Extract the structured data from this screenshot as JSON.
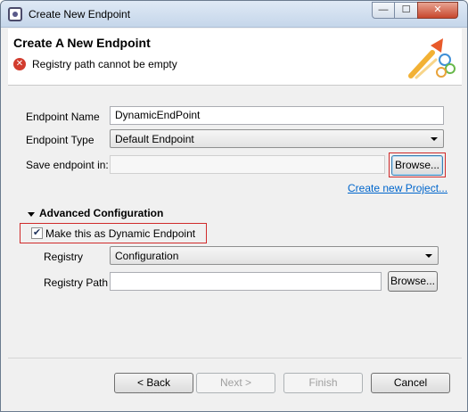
{
  "window": {
    "title": "Create New Endpoint",
    "controls": {
      "minimize": "—",
      "maximize": "☐",
      "close": "✕"
    }
  },
  "header": {
    "title": "Create A New Endpoint",
    "error_icon": "error-icon",
    "error_message": "Registry path cannot be empty"
  },
  "form": {
    "endpoint_name": {
      "label": "Endpoint Name",
      "value": "DynamicEndPoint"
    },
    "endpoint_type": {
      "label": "Endpoint Type",
      "value": "Default Endpoint"
    },
    "save_in": {
      "label": "Save endpoint in:",
      "value": "",
      "browse": "Browse..."
    },
    "create_project_link": "Create new Project..."
  },
  "advanced": {
    "title": "Advanced Configuration",
    "dynamic_checkbox": {
      "label": "Make this as Dynamic Endpoint",
      "checked": true,
      "check_glyph": "✔"
    },
    "registry": {
      "label": "Registry",
      "value": "Configuration"
    },
    "registry_path": {
      "label": "Registry Path",
      "value": "",
      "browse": "Browse..."
    }
  },
  "footer": {
    "back": "< Back",
    "next": "Next >",
    "finish": "Finish",
    "cancel": "Cancel"
  },
  "colors": {
    "highlight_border": "#d02a2a",
    "link": "#0066cc",
    "error": "#d23c2e"
  }
}
